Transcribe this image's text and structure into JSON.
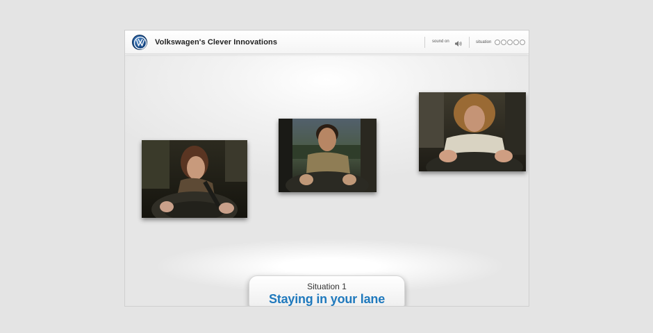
{
  "header": {
    "title": "Volkswagen's Clever Innovations",
    "sound_label": "sound on",
    "situation_label": "situation",
    "situation_dots": 5,
    "logo_icon": "vw-logo-icon",
    "speaker_icon": "speaker-icon"
  },
  "photos": [
    {
      "name": "woman-driver",
      "alt": "woman-driver-photo"
    },
    {
      "name": "man-driver-dark-hair",
      "alt": "man-driver-photo"
    },
    {
      "name": "man-driver-curly-hair",
      "alt": "man-driver-curly-photo"
    }
  ],
  "caption": {
    "subtitle": "Situation 1",
    "title": "Staying in your lane"
  },
  "colors": {
    "accent": "#1f79bd",
    "background": "#e4e4e4",
    "logo": "#0d3e7a"
  }
}
